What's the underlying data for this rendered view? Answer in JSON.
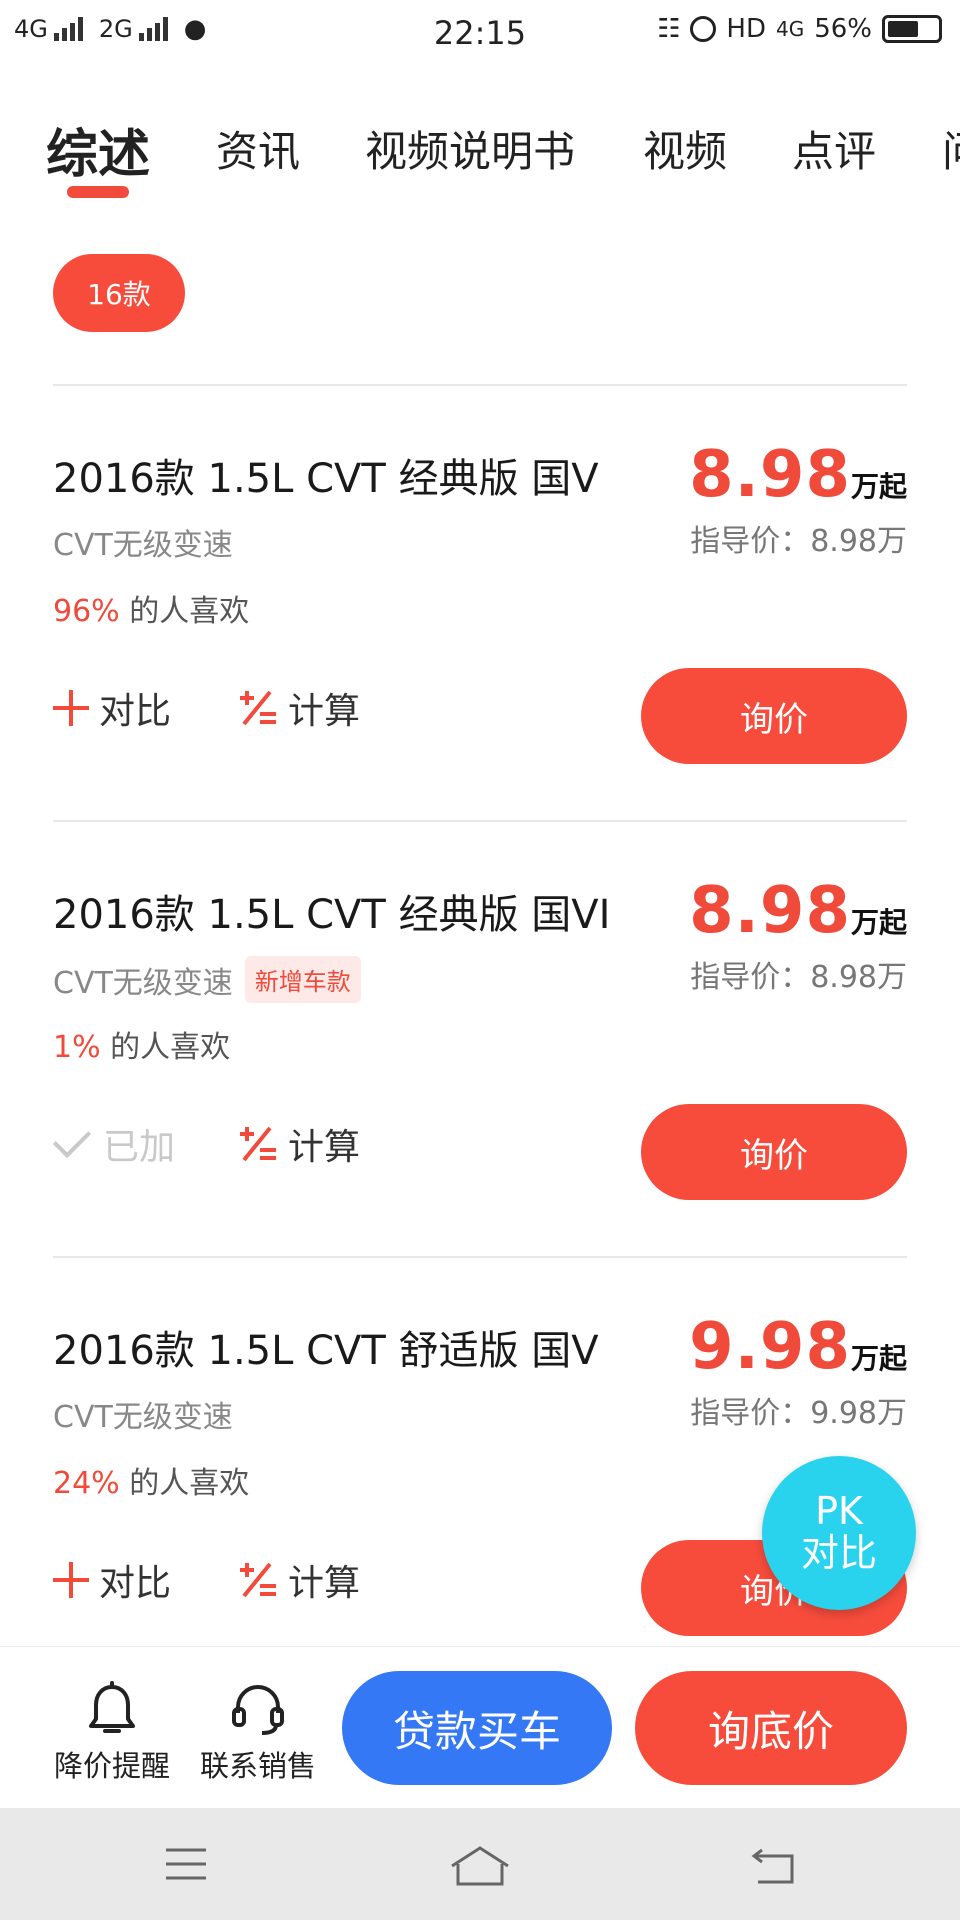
{
  "status_bar": {
    "network_1": "4G",
    "network_2": "2G",
    "time": "22:15",
    "hd": "HD",
    "network_3": "4G",
    "battery": "56%"
  },
  "tabs": [
    {
      "label": "综述",
      "active": true
    },
    {
      "label": "资讯",
      "active": false
    },
    {
      "label": "视频说明书",
      "active": false
    },
    {
      "label": "视频",
      "active": false
    },
    {
      "label": "点评",
      "active": false
    },
    {
      "label": "问",
      "active": false
    }
  ],
  "filter_chip": "16款",
  "cars": [
    {
      "title": "2016款 1.5L CVT 经典版 国V",
      "transmission": "CVT无级变速",
      "badge": "",
      "like_pct": "96%",
      "like_text": "的人喜欢",
      "price": "8.98",
      "price_unit": "万起",
      "guide_price": "指导价：8.98万",
      "compare_label": "对比",
      "compare_added": false,
      "calc_label": "计算",
      "ask_label": "询价"
    },
    {
      "title": "2016款 1.5L CVT 经典版 国VI",
      "transmission": "CVT无级变速",
      "badge": "新增车款",
      "like_pct": "1%",
      "like_text": "的人喜欢",
      "price": "8.98",
      "price_unit": "万起",
      "guide_price": "指导价：8.98万",
      "compare_label": "已加",
      "compare_added": true,
      "calc_label": "计算",
      "ask_label": "询价"
    },
    {
      "title": "2016款 1.5L CVT 舒适版 国V",
      "transmission": "CVT无级变速",
      "badge": "",
      "like_pct": "24%",
      "like_text": "的人喜欢",
      "price": "9.98",
      "price_unit": "万起",
      "guide_price": "指导价：9.98万",
      "compare_label": "对比",
      "compare_added": false,
      "calc_label": "计算",
      "ask_label": "询价"
    }
  ],
  "floating": {
    "line1": "PK",
    "line2": "对比"
  },
  "bottom_bar": {
    "price_alert": "降价提醒",
    "contact_sales": "联系销售",
    "loan_button": "贷款买车",
    "lowest_price_button": "询底价"
  },
  "colors": {
    "accent_red": "#f74c3c",
    "loan_blue": "#3478f6",
    "pk_cyan": "#29d3ee"
  },
  "icons": [
    "bell-icon",
    "headset-icon",
    "menu-icon",
    "home-icon",
    "back-icon",
    "plus-icon",
    "check-icon",
    "calculator-icon"
  ]
}
